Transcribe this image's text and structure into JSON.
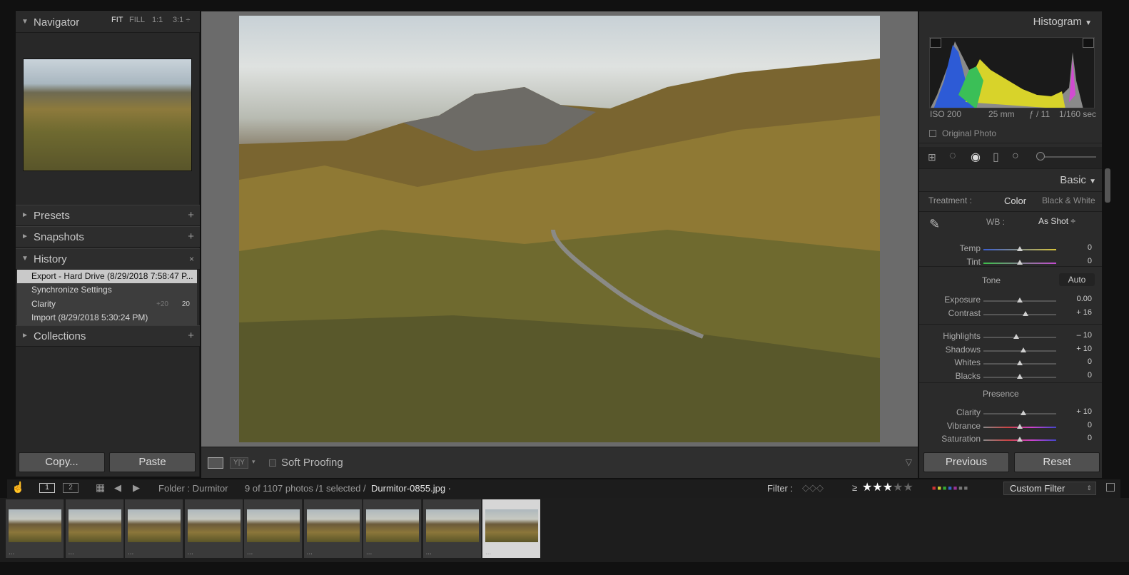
{
  "left": {
    "navigator": {
      "title": "Navigator",
      "opts": [
        "FIT",
        "FILL",
        "1:1",
        "3:1 ÷"
      ]
    },
    "panels": {
      "presets": "Presets",
      "snapshots": "Snapshots",
      "history": "History",
      "collections": "Collections"
    },
    "history_items": [
      {
        "label": "Export - Hard Drive (8/29/2018 7:58:47 P...",
        "a": "",
        "b": ""
      },
      {
        "label": "Synchronize Settings",
        "a": "",
        "b": ""
      },
      {
        "label": "Clarity",
        "a": "+20",
        "b": "20"
      },
      {
        "label": "Import (8/29/2018 5:30:24 PM)",
        "a": "",
        "b": ""
      }
    ],
    "copy": "Copy...",
    "paste": "Paste"
  },
  "toolbar": {
    "soft_proofing": "Soft Proofing"
  },
  "right": {
    "histogram_title": "Histogram",
    "exif": {
      "iso": "ISO 200",
      "focal": "25 mm",
      "aperture": "ƒ / 11",
      "shutter": "1/160 sec"
    },
    "original_photo": "Original Photo",
    "basic_title": "Basic",
    "treatment_label": "Treatment :",
    "treatment_color": "Color",
    "treatment_bw": "Black & White",
    "wb_label": "WB :",
    "wb_value": "As Shot ÷",
    "tone_label": "Tone",
    "auto": "Auto",
    "presence_label": "Presence",
    "sliders": [
      {
        "name": "Temp",
        "value": "0",
        "pos": 0.5
      },
      {
        "name": "Tint",
        "value": "0",
        "pos": 0.5
      },
      {
        "name": "Exposure",
        "value": "0.00",
        "pos": 0.5
      },
      {
        "name": "Contrast",
        "value": "+ 16",
        "pos": 0.58
      },
      {
        "name": "Highlights",
        "value": "– 10",
        "pos": 0.45
      },
      {
        "name": "Shadows",
        "value": "+ 10",
        "pos": 0.55
      },
      {
        "name": "Whites",
        "value": "0",
        "pos": 0.5
      },
      {
        "name": "Blacks",
        "value": "0",
        "pos": 0.5
      },
      {
        "name": "Clarity",
        "value": "+ 10",
        "pos": 0.55
      },
      {
        "name": "Vibrance",
        "value": "0",
        "pos": 0.5
      },
      {
        "name": "Saturation",
        "value": "0",
        "pos": 0.5
      }
    ],
    "previous": "Previous",
    "reset": "Reset"
  },
  "filterbar": {
    "page1": "1",
    "page2": "2",
    "folder": "Folder : Durmitor",
    "count": "9 of 1107 photos /1 selected /",
    "filename": "Durmitor-0855.jpg ·",
    "filter_label": "Filter :",
    "rating": "≥",
    "custom_filter": "Custom Filter"
  },
  "filmstrip_count": 9
}
